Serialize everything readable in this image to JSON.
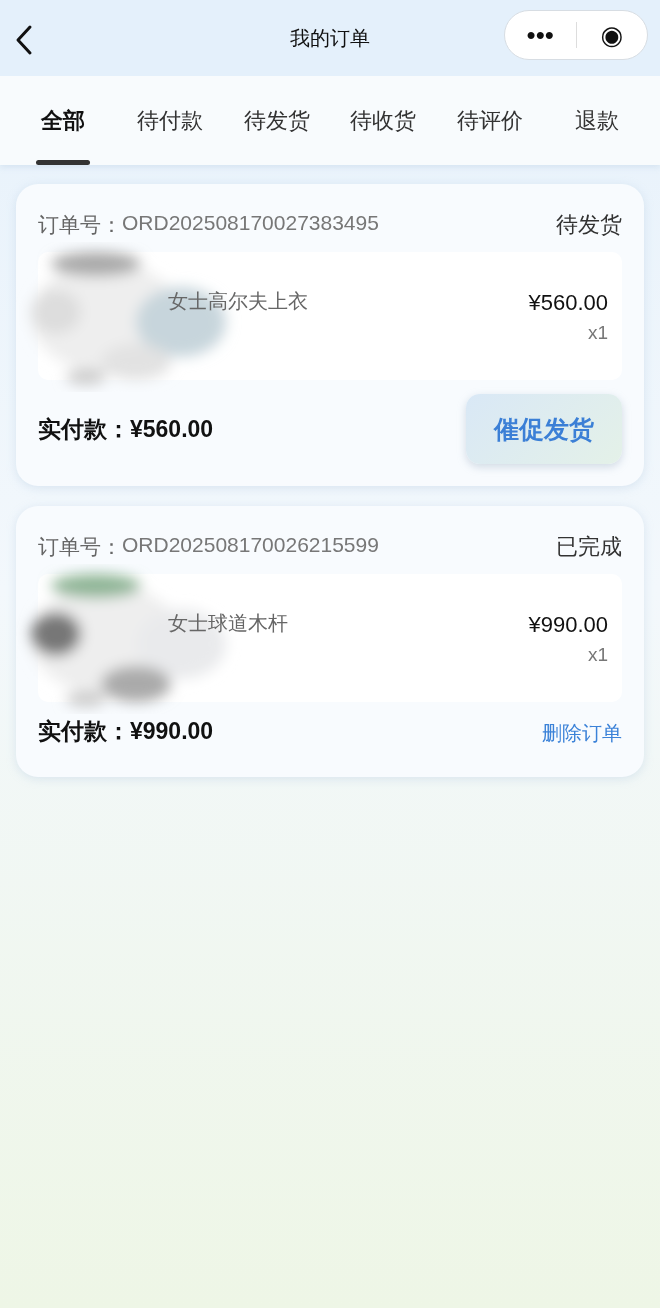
{
  "header": {
    "title": "我的订单",
    "capsule": [
      "•••",
      "◉"
    ]
  },
  "tabs": [
    {
      "label": "全部",
      "selected": true
    },
    {
      "label": "待付款",
      "selected": false
    },
    {
      "label": "待发货",
      "selected": false
    },
    {
      "label": "待收货",
      "selected": false
    },
    {
      "label": "待评价",
      "selected": false
    },
    {
      "label": "退款",
      "selected": false
    }
  ],
  "orders": [
    {
      "number_label": "订单号：",
      "number": "ORD202508170027383495",
      "status": "待发货",
      "item": {
        "name": "女士高尔夫上衣",
        "price": "¥560.00",
        "qty": "x1"
      },
      "total": "实付款：¥560.00",
      "action": {
        "kind": "button",
        "label": "催促发货"
      }
    },
    {
      "number_label": "订单号：",
      "number": "ORD202508170026215599",
      "status": "已完成",
      "item": {
        "name": "女士球道木杆",
        "price": "¥990.00",
        "qty": "x1"
      },
      "total": "实付款：¥990.00",
      "action": {
        "kind": "link",
        "label": "删除订单"
      }
    }
  ]
}
